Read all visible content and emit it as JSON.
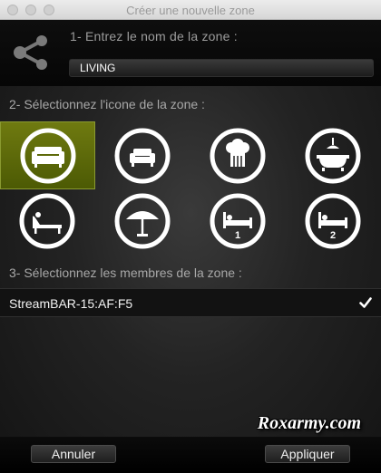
{
  "window": {
    "title": "Créer une nouvelle zone"
  },
  "step1": {
    "label": "1- Entrez le nom de la zone :",
    "value": "LIVING",
    "icon": "share-icon"
  },
  "step2": {
    "label": "2- Sélectionnez l'icone de la zone :",
    "selected_index": 0,
    "icons": [
      {
        "name": "sofa-large-icon"
      },
      {
        "name": "sofa-small-icon"
      },
      {
        "name": "chef-hat-icon"
      },
      {
        "name": "bathtub-shower-icon"
      },
      {
        "name": "sun-lounger-icon"
      },
      {
        "name": "parasol-icon"
      },
      {
        "name": "bed-1-icon",
        "label": "1"
      },
      {
        "name": "bed-2-icon",
        "label": "2"
      }
    ]
  },
  "step3": {
    "label": "3- Sélectionnez les membres de la zone :",
    "members": [
      {
        "name": "StreamBAR-15:AF:F5",
        "checked": true
      }
    ]
  },
  "watermark": "Roxarmy.com",
  "buttons": {
    "cancel": "Annuler",
    "apply": "Appliquer"
  },
  "colors": {
    "selected_bg": "#5f6c0a"
  }
}
